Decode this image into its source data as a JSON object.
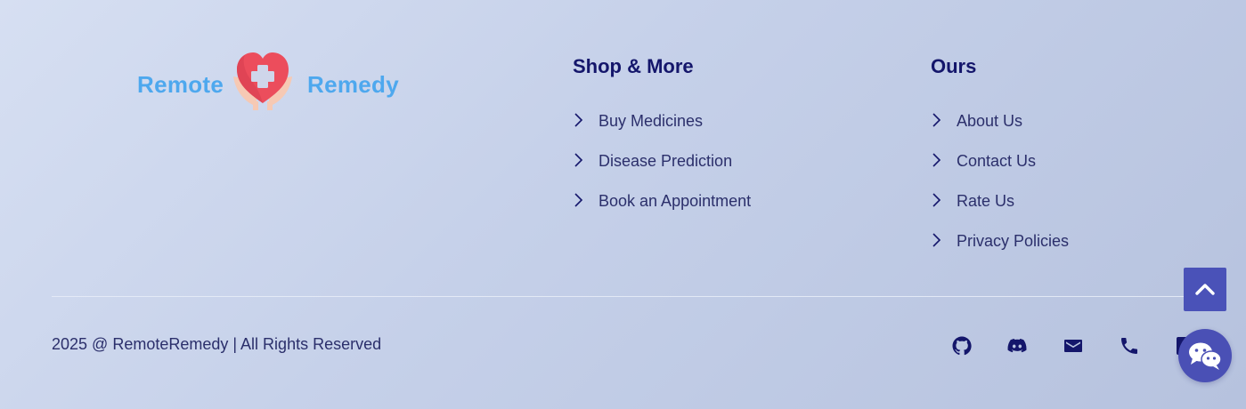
{
  "brand": {
    "name_left": "Remote",
    "name_right": "Remedy",
    "logo_icon": "heart-hands-cross-icon",
    "color": "#4ea8ee"
  },
  "columns": {
    "shop": {
      "title": "Shop & More",
      "links": [
        {
          "label": "Buy Medicines"
        },
        {
          "label": "Disease Prediction"
        },
        {
          "label": "Book an Appointment"
        }
      ]
    },
    "ours": {
      "title": "Ours",
      "links": [
        {
          "label": "About Us"
        },
        {
          "label": "Contact Us"
        },
        {
          "label": "Rate Us"
        },
        {
          "label": "Privacy Policies"
        }
      ]
    }
  },
  "copyright": "2025 @ RemoteRemedy | All Rights Reserved",
  "social": [
    "github-icon",
    "discord-icon",
    "mail-icon",
    "phone-icon",
    "linkedin-icon"
  ],
  "buttons": {
    "scroll_top_icon": "chevron-up-icon",
    "chat_icon": "chat-bubbles-icon"
  },
  "colors": {
    "heading": "#14166b",
    "text": "#2b2f6b",
    "accent": "#4a52b8",
    "icon": "#14166b"
  }
}
